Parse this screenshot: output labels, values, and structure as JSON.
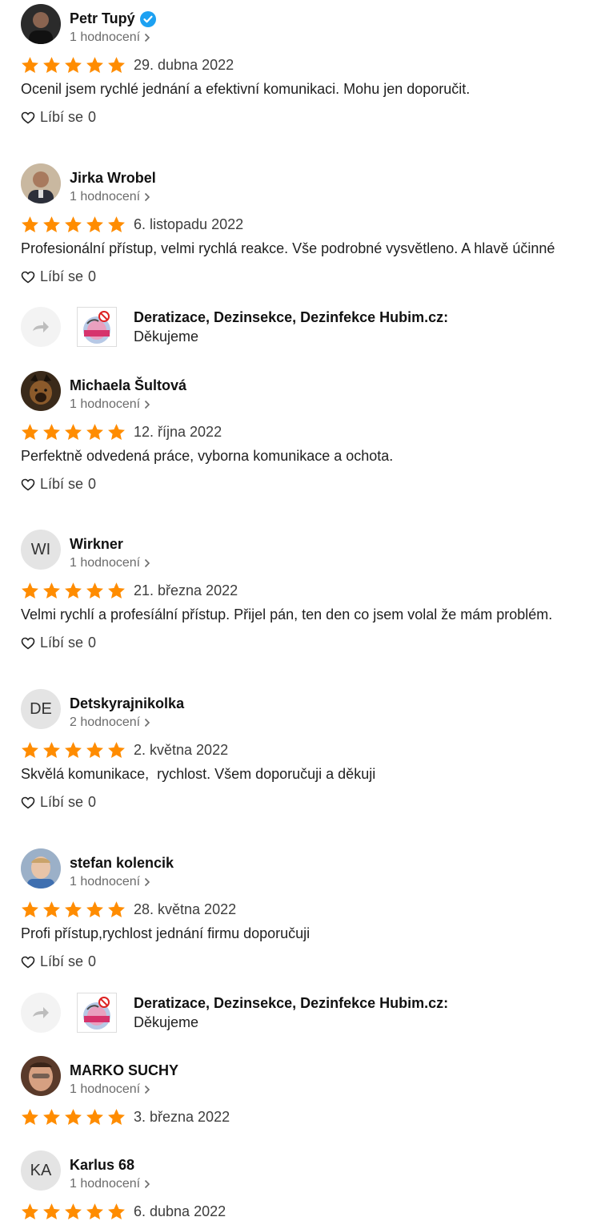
{
  "colors": {
    "star": "#ff8c00",
    "verified": "#1da1f2",
    "muted": "#6b6b6b"
  },
  "reviews": [
    {
      "name": "Petr Tupý",
      "verified": true,
      "count": "1 hodnocení",
      "date": "29. dubna 2022",
      "text": "Ocenil jsem rychlé jednání a efektivní komunikaci. Mohu jen doporučit.",
      "like_label": "Líbí se",
      "likes": "0",
      "rating": 5
    },
    {
      "name": "Jirka Wrobel",
      "verified": false,
      "count": "1 hodnocení",
      "date": "6. listopadu 2022",
      "text": "Profesionální přístup, velmi rychlá reakce. Vše podrobné vysvětleno. A hlavě účinné",
      "like_label": "Líbí se",
      "likes": "0",
      "rating": 5
    },
    {
      "name": "Michaela Šultová",
      "verified": false,
      "count": "1 hodnocení",
      "date": "12. října 2022",
      "text": "Perfektně odvedená práce, vyborna komunikace a ochota.",
      "like_label": "Líbí se",
      "likes": "0",
      "rating": 5
    },
    {
      "name": "Wirkner",
      "initials": "WI",
      "verified": false,
      "count": "1 hodnocení",
      "date": "21. března 2022",
      "text": "Velmi rychlí a profesíální přístup. Přijel pán, ten den co jsem volal že mám problém.",
      "like_label": "Líbí se",
      "likes": "0",
      "rating": 5
    },
    {
      "name": "Detskyrajnikolka",
      "initials": "DE",
      "verified": false,
      "count": "2 hodnocení",
      "date": "2. května 2022",
      "text": "Skvělá komunikace,  rychlost. Všem doporučuji a děkuji",
      "like_label": "Líbí se",
      "likes": "0",
      "rating": 5
    },
    {
      "name": "stefan kolencik",
      "verified": false,
      "count": "1 hodnocení",
      "date": "28. května 2022",
      "text": "Profi přístup,rychlost jednání firmu doporučuji",
      "like_label": "Líbí se",
      "likes": "0",
      "rating": 5
    },
    {
      "name": "MARKO SUCHY",
      "verified": false,
      "count": "1 hodnocení",
      "date": "3. března 2022",
      "rating": 5
    },
    {
      "name": "Karlus 68",
      "initials": "KA",
      "verified": false,
      "count": "1 hodnocení",
      "date": "6. dubna 2022",
      "rating": 5
    }
  ],
  "replies": [
    {
      "owner": "Deratizace, Dezinsekce, Dezinfekce Hubim.cz:",
      "text": "Děkujeme",
      "logo_text": "DERATIZACE"
    },
    {
      "owner": "Deratizace, Dezinsekce, Dezinfekce Hubim.cz:",
      "text": "Děkujeme",
      "logo_text": "DERATIZACE"
    }
  ]
}
